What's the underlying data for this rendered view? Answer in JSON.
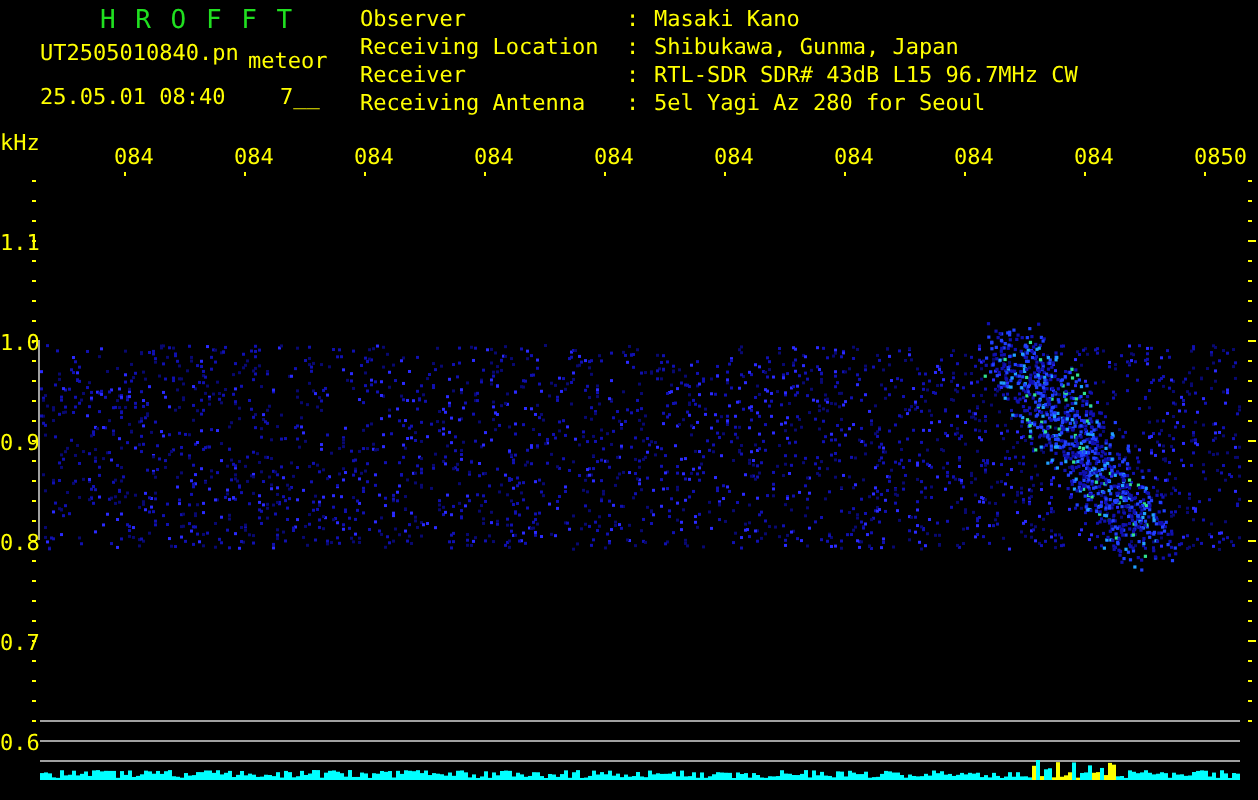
{
  "header": {
    "title": "H R O F F T",
    "filename": "UT2505010840.pn",
    "tag": "meteor",
    "timestamp": "25.05.01 08:40",
    "count": "7__"
  },
  "info": [
    {
      "label": "Observer",
      "separator": ":",
      "value": "Masaki Kano"
    },
    {
      "label": "Receiving Location",
      "separator": ":",
      "value": "Shibukawa, Gunma, Japan"
    },
    {
      "label": "Receiver",
      "separator": ":",
      "value": "RTL-SDR SDR# 43dB L15 96.7MHz CW"
    },
    {
      "label": "Receiving Antenna",
      "separator": ":",
      "value": "5el Yagi Az 280 for Seoul"
    }
  ],
  "plot": {
    "unit": "kHz",
    "time_labels": [
      "084",
      "084",
      "084",
      "084",
      "084",
      "084",
      "084",
      "084",
      "084",
      "0850"
    ],
    "frequency_labels": [
      "1.1",
      "1.0",
      "0.9",
      "0.8",
      "0.7",
      "0.6"
    ]
  }
}
